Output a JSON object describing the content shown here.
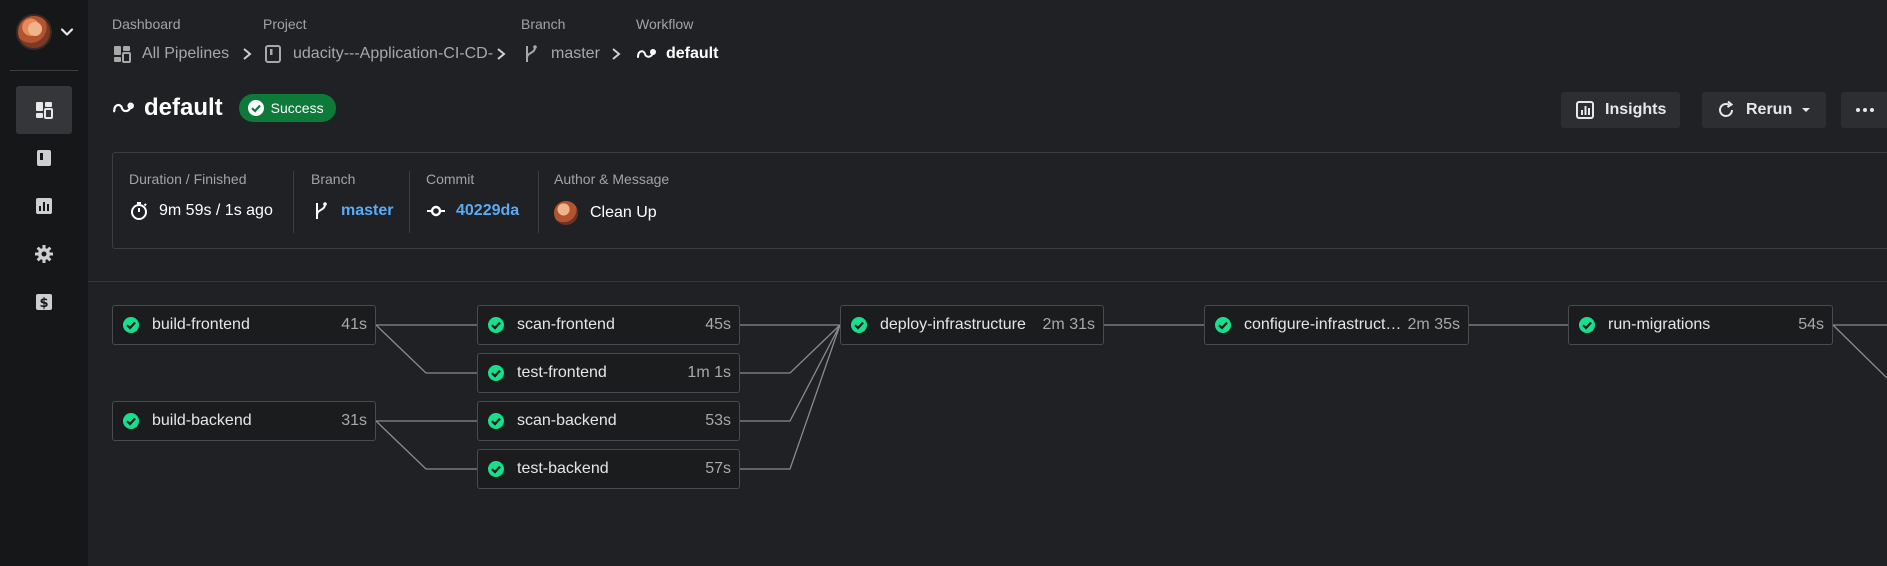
{
  "breadcrumb": [
    {
      "label": "Dashboard",
      "value": "All Pipelines",
      "icon": "dashboard-icon"
    },
    {
      "label": "Project",
      "value": "udacity---Application-CI-CD-",
      "icon": "project-book-icon"
    },
    {
      "label": "Branch",
      "value": "master",
      "icon": "branch-icon"
    },
    {
      "label": "Workflow",
      "value": "default",
      "icon": "workflow-icon"
    }
  ],
  "header": {
    "title": "default",
    "status": "Success",
    "insights_label": "Insights",
    "rerun_label": "Rerun"
  },
  "summary": {
    "duration_label": "Duration / Finished",
    "duration_value": "9m 59s / 1s ago",
    "branch_label": "Branch",
    "branch_value": "master",
    "commit_label": "Commit",
    "commit_value": "40229da",
    "author_label": "Author & Message",
    "author_message": "Clean Up"
  },
  "jobs": [
    {
      "name": "build-frontend",
      "duration": "41s",
      "status": "success"
    },
    {
      "name": "scan-frontend",
      "duration": "45s",
      "status": "success"
    },
    {
      "name": "test-frontend",
      "duration": "1m 1s",
      "status": "success"
    },
    {
      "name": "build-backend",
      "duration": "31s",
      "status": "success"
    },
    {
      "name": "scan-backend",
      "duration": "53s",
      "status": "success"
    },
    {
      "name": "test-backend",
      "duration": "57s",
      "status": "success"
    },
    {
      "name": "deploy-infrastructure",
      "duration": "2m 31s",
      "status": "success"
    },
    {
      "name": "configure-infrastructu...",
      "duration": "2m 35s",
      "status": "success"
    },
    {
      "name": "run-migrations",
      "duration": "54s",
      "status": "success"
    }
  ],
  "colors": {
    "success": "#0d7a3a",
    "success_check": "#16e08c",
    "link": "#5aabf5",
    "background": "#202124",
    "sidebar": "#161719"
  }
}
